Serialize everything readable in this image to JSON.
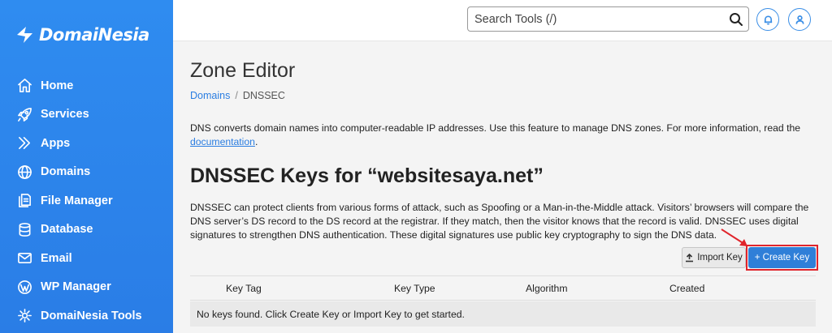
{
  "sidebar": {
    "logo_text": "DomaiNesia",
    "items": [
      {
        "label": "Home",
        "icon": "home-icon"
      },
      {
        "label": "Services",
        "icon": "rocket-icon"
      },
      {
        "label": "Apps",
        "icon": "apps-icon"
      },
      {
        "label": "Domains",
        "icon": "globe-icon"
      },
      {
        "label": "File Manager",
        "icon": "file-icon"
      },
      {
        "label": "Database",
        "icon": "database-icon"
      },
      {
        "label": "Email",
        "icon": "email-icon"
      },
      {
        "label": "WP Manager",
        "icon": "wordpress-icon"
      },
      {
        "label": "DomaiNesia Tools",
        "icon": "tools-icon"
      }
    ]
  },
  "header": {
    "search_placeholder": "Search Tools (/)",
    "icons": [
      "search-icon",
      "bell-icon",
      "user-icon"
    ]
  },
  "main": {
    "title": "Zone Editor",
    "breadcrumb": {
      "link": "Domains",
      "current": "DNSSEC"
    },
    "intro_text": "DNS converts domain names into computer-readable IP addresses. Use this feature to manage DNS zones. For more information, read the",
    "intro_link": "documentation",
    "intro_end": ".",
    "section_title": "DNSSEC Keys for “websitesaya.net”",
    "description": "DNSSEC can protect clients from various forms of attack, such as Spoofing or a Man-in-the-Middle attack. Visitors’ browsers will compare the DNS server’s DS record to the DS record at the registrar. If they match, then the visitor knows that the record is valid. DNSSEC uses digital signatures to strengthen DNS authentication. These digital signatures use public key cryptography to sign the DNS data.",
    "import_label": "Import Key",
    "create_label": "+ Create Key",
    "table": {
      "columns": [
        "Key Tag",
        "Key Type",
        "Algorithm",
        "Created"
      ],
      "empty_message": "No keys found. Click Create Key or Import Key to get started."
    }
  },
  "colors": {
    "sidebar": "#2f8cf0",
    "accent": "#2a7de1",
    "highlight": "#e0242b"
  }
}
